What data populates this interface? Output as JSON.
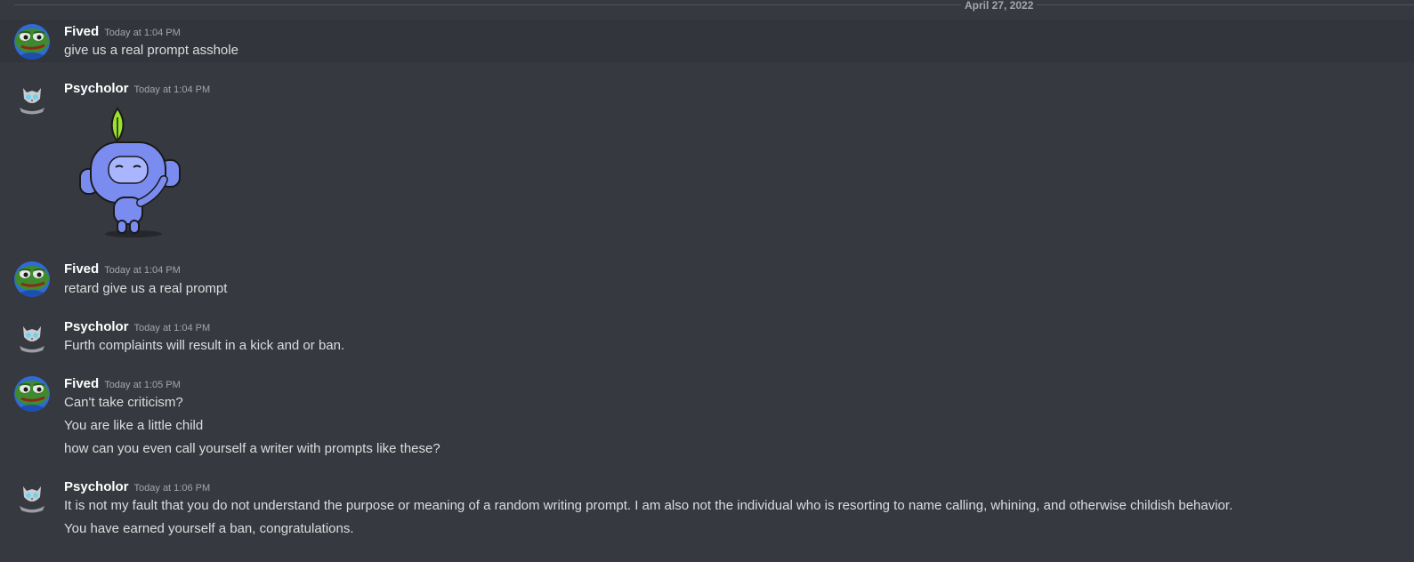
{
  "divider": {
    "date": "April 27, 2022"
  },
  "messages": [
    {
      "author": "Fived",
      "timestamp": "Today at 1:04 PM",
      "lines": [
        "give us a real prompt asshole"
      ]
    },
    {
      "author": "Psycholor",
      "timestamp": "Today at 1:04 PM",
      "sticker": "wumpus-leaf-wave-sticker"
    },
    {
      "author": "Fived",
      "timestamp": "Today at 1:04 PM",
      "lines": [
        "retard give us a real prompt"
      ]
    },
    {
      "author": "Psycholor",
      "timestamp": "Today at 1:04 PM",
      "lines": [
        "Furth complaints will result in a kick and or ban."
      ]
    },
    {
      "author": "Fived",
      "timestamp": "Today at 1:05 PM",
      "lines": [
        "Can't take criticism?",
        "You are like a little child",
        "how can you even call yourself a writer with prompts like these?"
      ]
    },
    {
      "author": "Psycholor",
      "timestamp": "Today at 1:06 PM",
      "lines": [
        "It is not my fault that you do not understand the purpose or meaning of a random writing prompt. I am also not the individual who is resorting to name calling, whining, and otherwise childish behavior.",
        "You have earned yourself a ban, congratulations."
      ]
    }
  ],
  "colors": {
    "background": "#36393f",
    "hover_background": "#32353b",
    "username": "#ffffff",
    "message_text": "#dcddde",
    "timestamp": "#a3a6aa",
    "wumpus": "#7b8cf0",
    "leaf": "#9be22d"
  },
  "icons": {
    "fived_avatar": "pepe-frog-avatar-icon",
    "psycholor_avatar": "owl-emblem-avatar-icon"
  }
}
